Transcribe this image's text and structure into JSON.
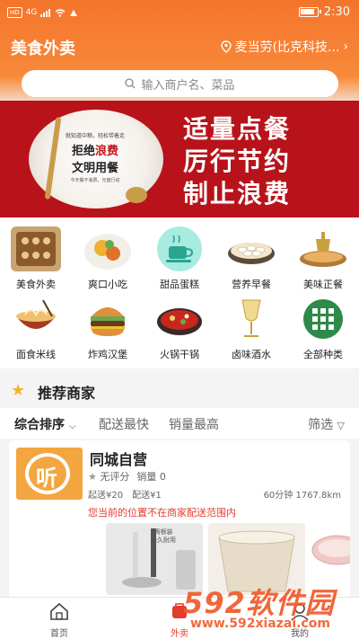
{
  "status_bar": {
    "left_badges": [
      "HD",
      "4G"
    ],
    "time": "2:30"
  },
  "header": {
    "title": "美食外卖",
    "location": "麦当劳(比克科技..."
  },
  "search": {
    "placeholder": "输入商户名、菜品"
  },
  "banner": {
    "plate_line1": "就知道中粮，轻松带着走",
    "plate_line2_prefix": "拒绝",
    "plate_line2_highlight": "浪费",
    "plate_line3": "文明用餐",
    "plate_line4": "今天餐不浪费，光盘行动",
    "slogan": [
      "适量点餐",
      "厉行节约",
      "制止浪费"
    ]
  },
  "categories": [
    {
      "label": "美食外卖",
      "icon": "waffle-icon"
    },
    {
      "label": "爽口小吃",
      "icon": "snack-plate-icon"
    },
    {
      "label": "甜品蛋糕",
      "icon": "coffee-cup-icon"
    },
    {
      "label": "营养早餐",
      "icon": "dumpling-icon"
    },
    {
      "label": "美味正餐",
      "icon": "hotpot-dish-icon"
    },
    {
      "label": "面食米线",
      "icon": "noodle-bowl-icon"
    },
    {
      "label": "炸鸡汉堡",
      "icon": "burger-icon"
    },
    {
      "label": "火锅干锅",
      "icon": "hotpot-icon"
    },
    {
      "label": "卤味酒水",
      "icon": "wine-glass-icon"
    },
    {
      "label": "全部种类",
      "icon": "grid-icon"
    }
  ],
  "recommend": {
    "title": "推荐商家"
  },
  "sort": {
    "default": "综合排序",
    "fastest": "配送最快",
    "bestsell": "销量最高",
    "filter": "筛选"
  },
  "shop": {
    "name": "同城自营",
    "rating": "无评分",
    "sales": "销量 0",
    "min_order": "起送¥20",
    "delivery_fee": "配送¥1",
    "distance": "60分钟 1767.8km",
    "warning": "您当前的位置不在商家配送范围内",
    "logo_glyph": "听",
    "products": [
      {
        "label": "两根装 经久耐用"
      },
      {
        "label": ""
      },
      {
        "label": ""
      }
    ]
  },
  "tabbar": {
    "home": "首页",
    "takeout": "外卖",
    "mine": "我的"
  },
  "watermark": {
    "brand": "592软件园",
    "url": "www.592xiazai.com"
  },
  "colors": {
    "primary": "#f4742c",
    "banner": "#b8131b",
    "warning": "#e23c2d"
  }
}
